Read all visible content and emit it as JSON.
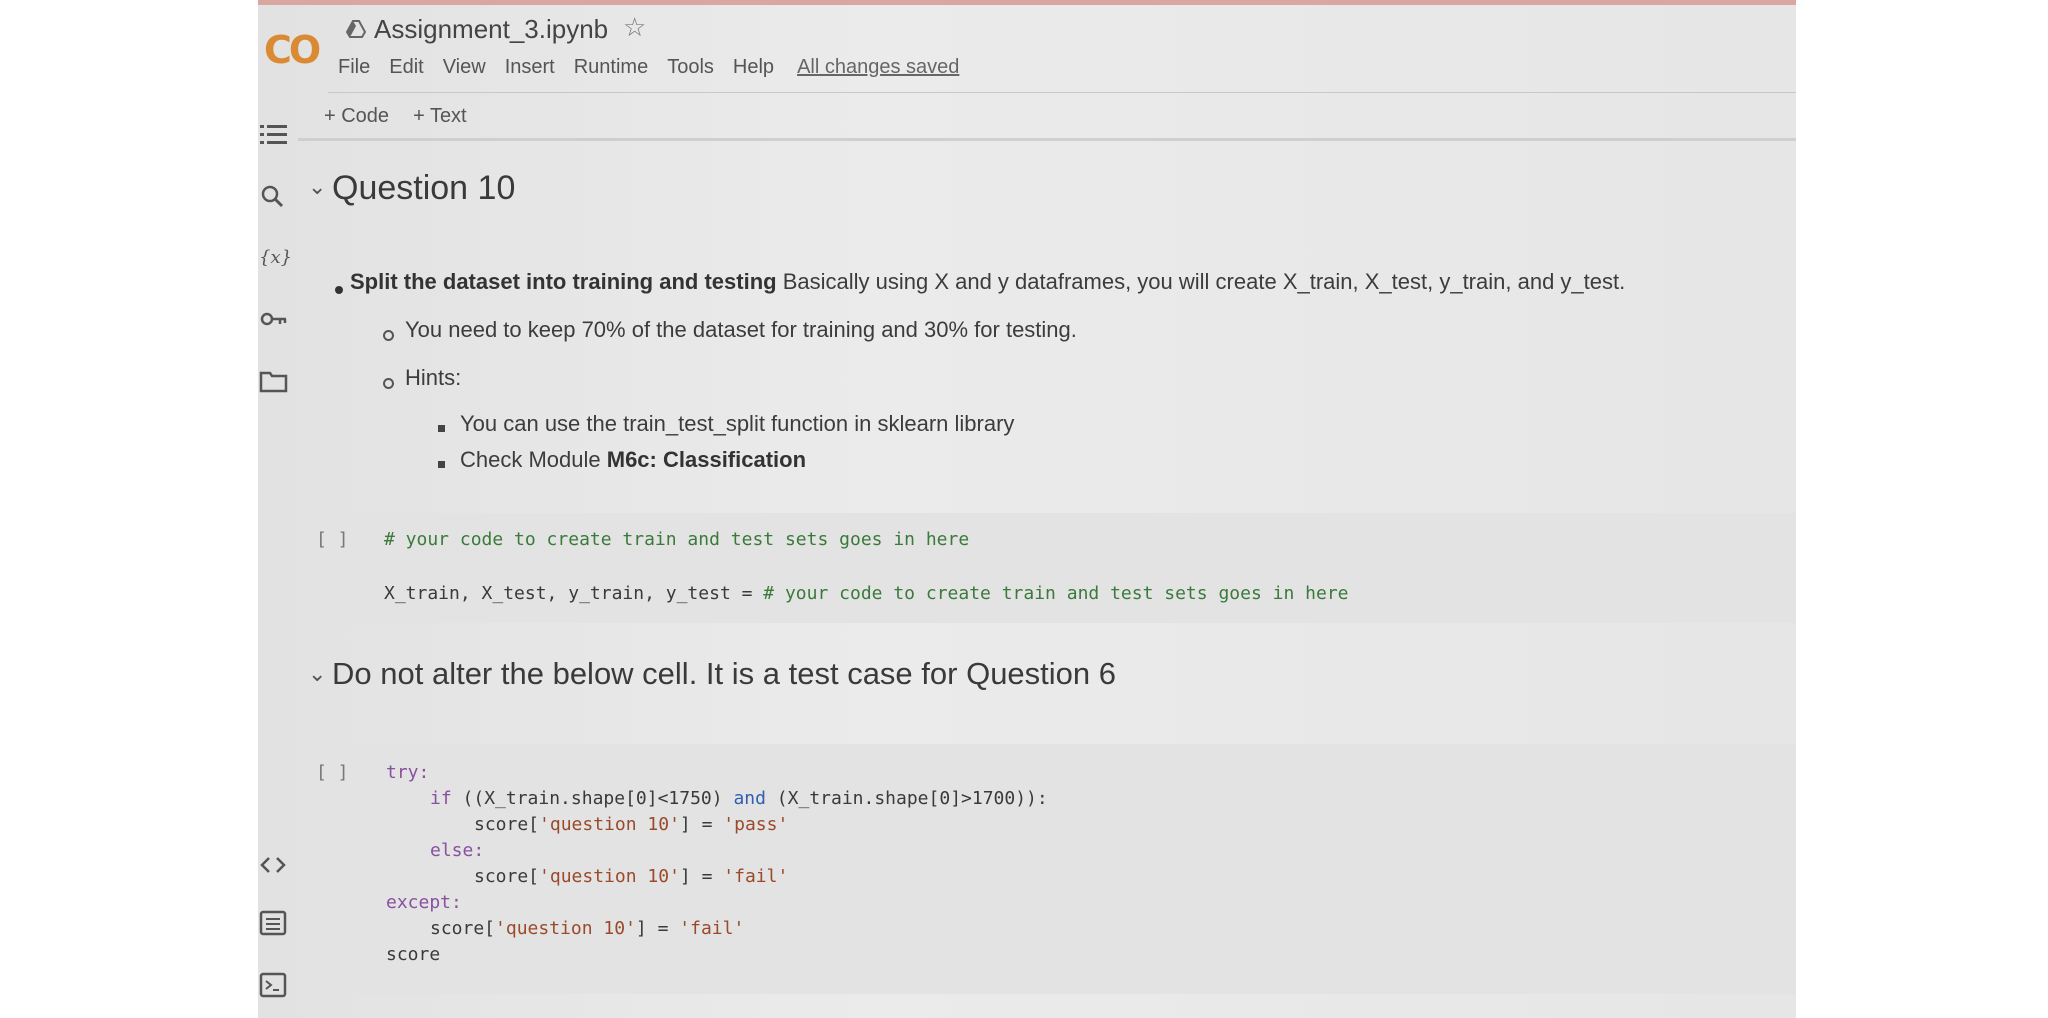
{
  "header": {
    "logo": "CO",
    "title": "Assignment_3.ipynb",
    "star_icon": "star-icon",
    "menu": [
      "File",
      "Edit",
      "View",
      "Insert",
      "Runtime",
      "Tools",
      "Help"
    ],
    "save_status": "All changes saved"
  },
  "toolbar": {
    "add_code": "+ Code",
    "add_text": "+ Text"
  },
  "left_rail": [
    "toc-icon",
    "search-icon",
    "variables-icon",
    "key-icon",
    "folder-icon",
    "code-snippets-icon",
    "command-palette-icon",
    "terminal-icon"
  ],
  "section1": {
    "title": "Question 10",
    "bullet_bold": "Split the dataset into training and testing",
    "bullet_rest": " Basically using X and y dataframes, you will create X_train, X_test, y_train, and y_test.",
    "sub1": "You need to keep 70% of the dataset for training and 30% for testing.",
    "sub2": "Hints:",
    "hint1": "You can use the train_test_split function in sklearn library",
    "hint2_prefix": "Check Module ",
    "hint2_bold": "M6c: Classification"
  },
  "cell1": {
    "run_label": "[ ]",
    "line1": "# your code to create train and test sets goes in here",
    "line2_code": "X_train, X_test, y_train, y_test = ",
    "line2_comment": "# your code to create train and test sets goes in here"
  },
  "section2": {
    "title": "Do not alter the below cell. It is a test case for Question 6"
  },
  "cell2": {
    "run_label": "[ ]",
    "l1": "try:",
    "l2_kw": "if",
    "l2_a": " ((X_train.shape[0]<1750) ",
    "l2_and": "and",
    "l2_b": " (X_train.shape[0]>1700)):",
    "l3_a": "score[",
    "l3_str": "'question 10'",
    "l3_b": "] = ",
    "l3_val": "'pass'",
    "l4": "else:",
    "l5_a": "score[",
    "l5_str": "'question 10'",
    "l5_b": "] = ",
    "l5_val": "'fail'",
    "l6": "except:",
    "l7_a": "score[",
    "l7_str": "'question 10'",
    "l7_b": "] = ",
    "l7_val": "'fail'",
    "l8": "score"
  }
}
